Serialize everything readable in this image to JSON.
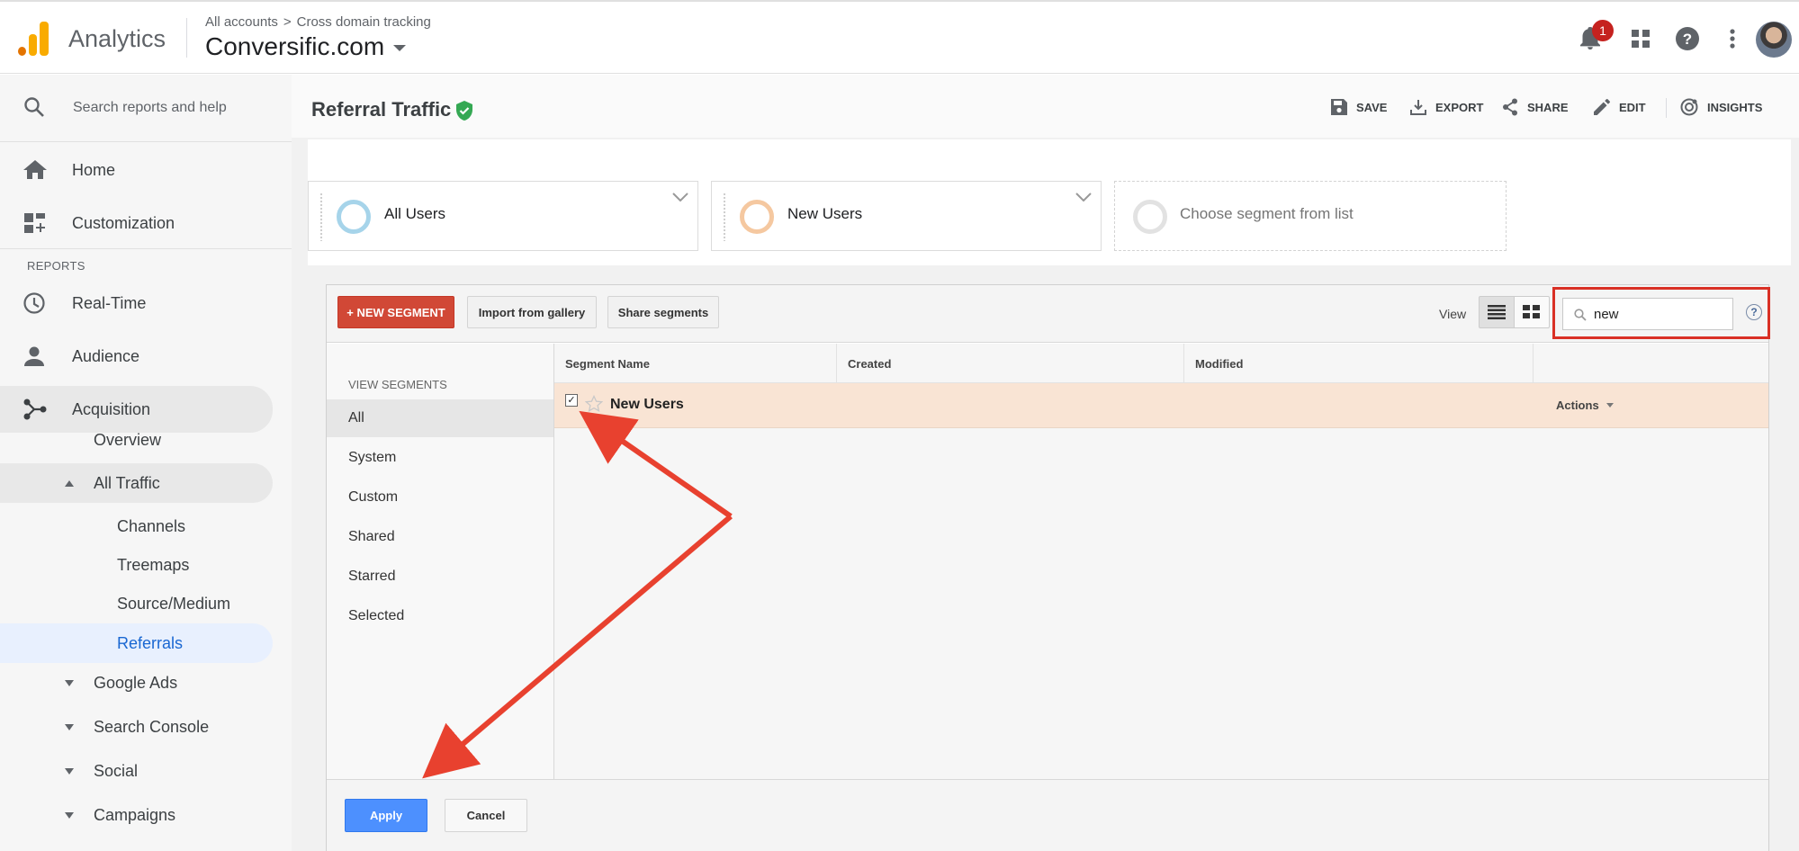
{
  "app": {
    "name": "Analytics",
    "brand_colors": [
      "#f9ab00",
      "#e37400"
    ]
  },
  "breadcrumb": {
    "account": "All accounts",
    "separator": ">",
    "property_path": "Cross domain tracking"
  },
  "property": {
    "name": "Conversific.com"
  },
  "topbar": {
    "notification_count": "1",
    "icons": [
      "notifications-icon",
      "apps-grid-icon",
      "help-icon",
      "more-vert-icon",
      "avatar"
    ]
  },
  "sidebar": {
    "search_placeholder": "Search reports and help",
    "items": [
      {
        "label": "Home",
        "icon": "home-icon"
      },
      {
        "label": "Customization",
        "icon": "dashboard-icon"
      }
    ],
    "reports_label": "REPORTS",
    "reports": [
      {
        "label": "Real-Time",
        "icon": "clock-icon"
      },
      {
        "label": "Audience",
        "icon": "person-icon"
      },
      {
        "label": "Acquisition",
        "icon": "acquisition-icon"
      }
    ],
    "acquisition_children": {
      "overview": "Overview",
      "all_traffic": "All Traffic",
      "all_traffic_children": [
        "Channels",
        "Treemaps",
        "Source/Medium",
        "Referrals"
      ],
      "collapsed": [
        "Google Ads",
        "Search Console",
        "Social",
        "Campaigns"
      ]
    }
  },
  "page": {
    "title": "Referral Traffic",
    "actions": {
      "save": "SAVE",
      "export": "EXPORT",
      "share": "SHARE",
      "edit": "EDIT",
      "insights": "INSIGHTS"
    }
  },
  "segments_bar": {
    "slots": [
      {
        "name": "All Users",
        "ring_color": "#a6d4ea"
      },
      {
        "name": "New Users",
        "ring_color": "#f5c8a0"
      },
      {
        "name": "Choose segment from list",
        "ring_color": "#e2e2e2"
      }
    ]
  },
  "segment_dialog": {
    "new_segment": "+ NEW SEGMENT",
    "import_gallery": "Import from gallery",
    "share_segments": "Share segments",
    "view_label": "View",
    "search_value": "new",
    "help": "?",
    "view_segments_label": "VIEW SEGMENTS",
    "filters": [
      "All",
      "System",
      "Custom",
      "Shared",
      "Starred",
      "Selected"
    ],
    "columns": [
      "Segment Name",
      "Created",
      "Modified"
    ],
    "rows": [
      {
        "name": "New Users",
        "checked": true,
        "starred": false,
        "actions": "Actions"
      }
    ],
    "apply": "Apply",
    "cancel": "Cancel"
  },
  "annotation_color": "#e8412f"
}
